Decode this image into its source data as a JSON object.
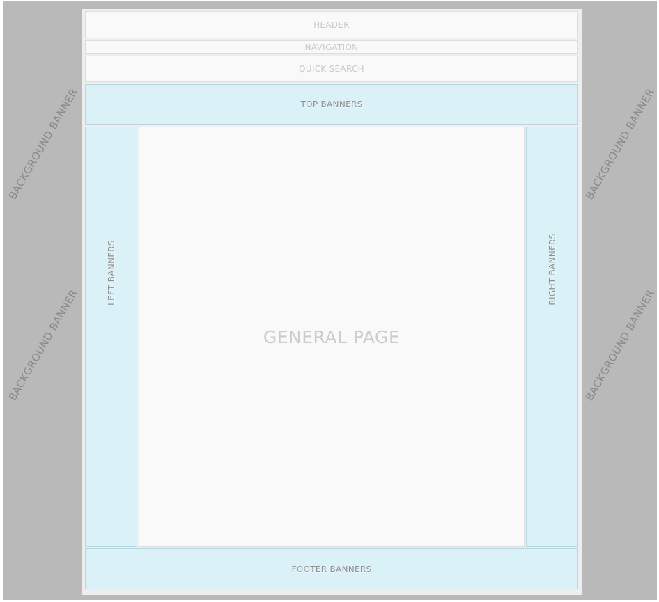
{
  "background_banners": [
    "BACKGROUND BANNER",
    "BACKGROUND BANNER",
    "BACKGROUND BANNER",
    "BACKGROUND BANNER"
  ],
  "header": "HEADER",
  "navigation": "NAVIGATION",
  "quick_search": "QUICK SEARCH",
  "top_banners": "TOP BANNERS",
  "left_banners": "LEFT BANNERS",
  "general_page": "GENERAL PAGE",
  "right_banners": "RIGHT BANNERS",
  "footer_banners": "FOOTER BANNERS",
  "colors": {
    "outer_background": "#b9b9b9",
    "page_background": "#eeeeee",
    "content_block": "#f9f9f9",
    "banner_block": "#daf1f7"
  }
}
